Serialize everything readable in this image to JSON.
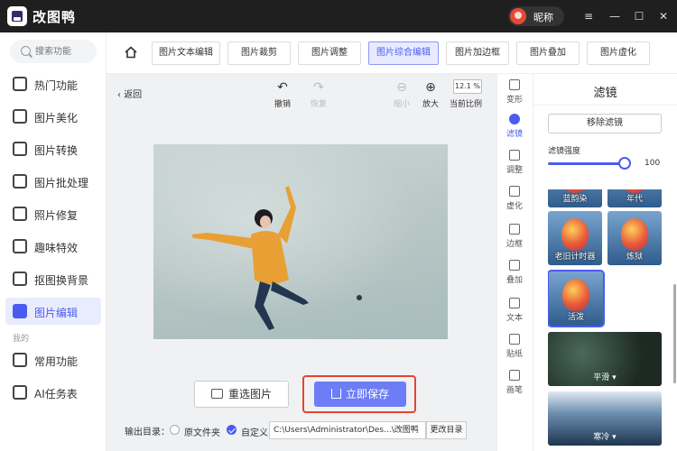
{
  "app": {
    "title": "改图鸭",
    "nickname": "昵称"
  },
  "window": {
    "settings": "≡",
    "minimize": "—",
    "maximize": "☐",
    "close": "✕"
  },
  "sidebar": {
    "search_placeholder": "搜索功能",
    "section_mine": "我的",
    "items": [
      {
        "label": "热门功能"
      },
      {
        "label": "图片美化"
      },
      {
        "label": "图片转换"
      },
      {
        "label": "图片批处理"
      },
      {
        "label": "照片修复"
      },
      {
        "label": "趣味特效"
      },
      {
        "label": "抠图换背景"
      },
      {
        "label": "图片编辑"
      },
      {
        "label": "常用功能"
      },
      {
        "label": "AI任务表"
      }
    ]
  },
  "tabs": [
    {
      "label": "图片文本编辑"
    },
    {
      "label": "图片裁剪"
    },
    {
      "label": "图片调整"
    },
    {
      "label": "图片综合编辑"
    },
    {
      "label": "图片加边框"
    },
    {
      "label": "图片叠加"
    },
    {
      "label": "图片虚化"
    }
  ],
  "editor": {
    "back": "返回",
    "undo": "撤销",
    "redo": "恢复",
    "zoom_out": "缩小",
    "zoom_in": "放大",
    "zoom_value": "12.1 %",
    "current_ratio": "当前比例",
    "reselect": "重选图片",
    "save_now": "立即保存",
    "output_label": "输出目录：",
    "opt_original": "原文件夹",
    "opt_custom": "自定义",
    "path": "C:\\Users\\Administrator\\Des...\\改图鸭",
    "change_dir": "更改目录"
  },
  "vtools": [
    {
      "label": "变形"
    },
    {
      "label": "滤镜"
    },
    {
      "label": "调整"
    },
    {
      "label": "虚化"
    },
    {
      "label": "边框"
    },
    {
      "label": "叠加"
    },
    {
      "label": "文本"
    },
    {
      "label": "贴纸"
    },
    {
      "label": "画笔"
    }
  ],
  "filter_panel": {
    "title": "滤镜",
    "remove": "移除滤镜",
    "strength_label": "滤镜强度",
    "strength_value": "100",
    "strength_fraction": 1.0,
    "thumbs": [
      {
        "label": "蓝韵染"
      },
      {
        "label": "年代"
      },
      {
        "label": "老旧计时器"
      },
      {
        "label": "炼狱"
      },
      {
        "label": "活泼"
      }
    ],
    "big_thumbs": [
      {
        "label": "平滑 ▾"
      },
      {
        "label": "寒冷 ▾"
      }
    ]
  }
}
